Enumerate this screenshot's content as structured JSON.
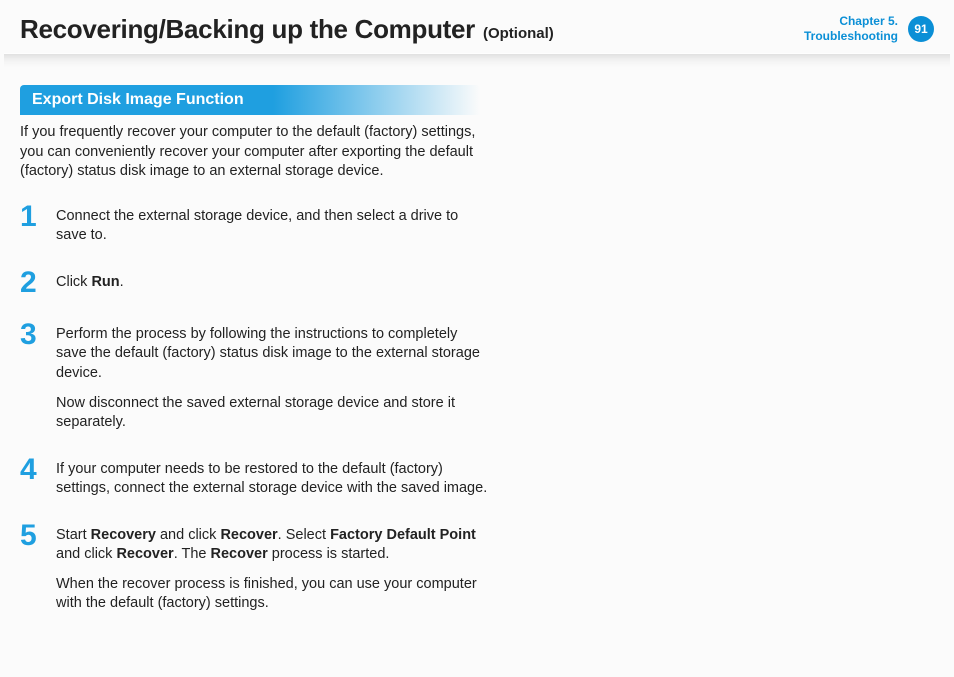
{
  "header": {
    "title": "Recovering/Backing up the Computer",
    "optional": "(Optional)",
    "chapter_line1": "Chapter 5.",
    "chapter_line2": "Troubleshooting",
    "page_num": "91"
  },
  "section": {
    "heading": "Export Disk Image Function",
    "intro": "If you frequently recover your computer to the default (factory) settings, you can conveniently recover your computer after exporting the default (factory) status disk image to an external storage device."
  },
  "steps": [
    {
      "num": "1",
      "paras": [
        {
          "segs": [
            {
              "t": "Connect the external storage device, and then select a drive to save to."
            }
          ]
        }
      ]
    },
    {
      "num": "2",
      "paras": [
        {
          "segs": [
            {
              "t": "Click "
            },
            {
              "t": "Run",
              "b": true
            },
            {
              "t": "."
            }
          ]
        }
      ]
    },
    {
      "num": "3",
      "paras": [
        {
          "segs": [
            {
              "t": "Perform the process by following the instructions to completely save the default (factory) status disk image to the external storage device."
            }
          ]
        },
        {
          "segs": [
            {
              "t": "Now disconnect the saved external storage device and store it separately."
            }
          ]
        }
      ]
    },
    {
      "num": "4",
      "paras": [
        {
          "segs": [
            {
              "t": "If your computer needs to be restored to the default (factory) settings, connect the external storage device with the saved image."
            }
          ]
        }
      ]
    },
    {
      "num": "5",
      "paras": [
        {
          "segs": [
            {
              "t": "Start "
            },
            {
              "t": "Recovery",
              "b": true
            },
            {
              "t": " and click "
            },
            {
              "t": "Recover",
              "b": true
            },
            {
              "t": ". Select "
            },
            {
              "t": "Factory Default Point",
              "b": true
            },
            {
              "t": " and click "
            },
            {
              "t": "Recover",
              "b": true
            },
            {
              "t": ". The "
            },
            {
              "t": "Recover",
              "b": true
            },
            {
              "t": " process is started."
            }
          ]
        },
        {
          "segs": [
            {
              "t": "When the recover process is finished, you can use your computer with the default (factory) settings."
            }
          ]
        }
      ]
    }
  ]
}
